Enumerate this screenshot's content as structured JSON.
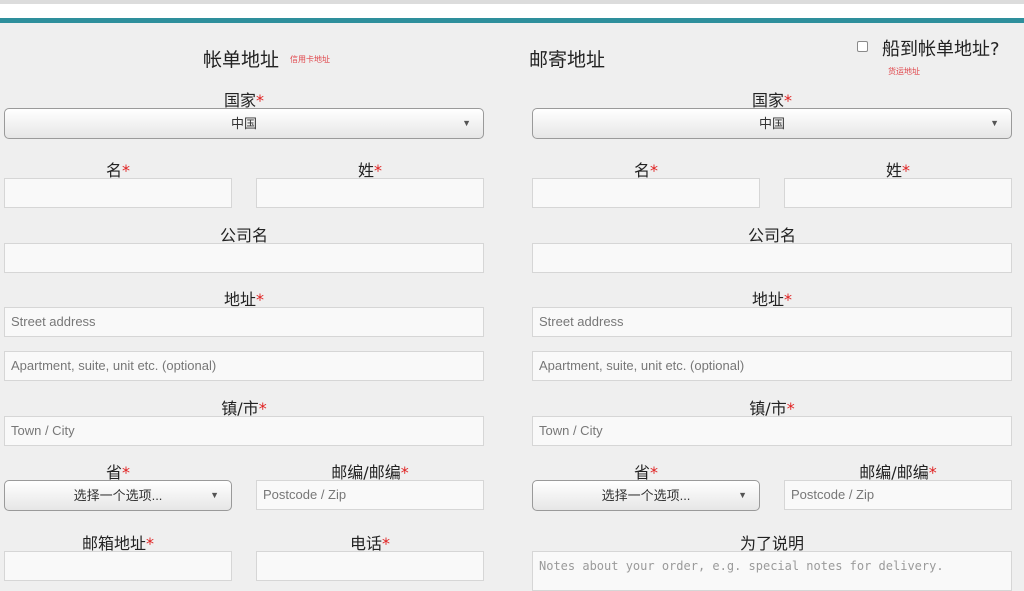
{
  "billing": {
    "heading": "帐单地址",
    "subnote": "信用卡地址",
    "country_label": "国家",
    "country_value": "中国",
    "first_name_label": "名",
    "last_name_label": "姓",
    "company_label": "公司名",
    "address_label": "地址",
    "street_placeholder": "Street address",
    "apartment_placeholder": "Apartment, suite, unit etc. (optional)",
    "city_label": "镇/市",
    "city_placeholder": "Town / City",
    "state_label": "省",
    "state_value": "选择一个选项...",
    "postcode_label": "邮编/邮编",
    "postcode_placeholder": "Postcode / Zip",
    "email_label": "邮箱地址",
    "phone_label": "电话"
  },
  "shipping": {
    "heading": "邮寄地址",
    "ship_to_billing_label": "船到帐单地址?",
    "ship_subnote": "货运地址",
    "country_label": "国家",
    "country_value": "中国",
    "first_name_label": "名",
    "last_name_label": "姓",
    "company_label": "公司名",
    "address_label": "地址",
    "street_placeholder": "Street address",
    "apartment_placeholder": "Apartment, suite, unit etc. (optional)",
    "city_label": "镇/市",
    "city_placeholder": "Town / City",
    "state_label": "省",
    "state_value": "选择一个选项...",
    "postcode_label": "邮编/邮编",
    "postcode_placeholder": "Postcode / Zip",
    "notes_label": "为了说明",
    "notes_placeholder": "Notes about your order, e.g. special notes for delivery."
  },
  "required_marker": "*",
  "colors": {
    "accent": "#2e8f9c",
    "required": "#e02020"
  },
  "icons": {
    "dropdown": "triangle-down"
  }
}
